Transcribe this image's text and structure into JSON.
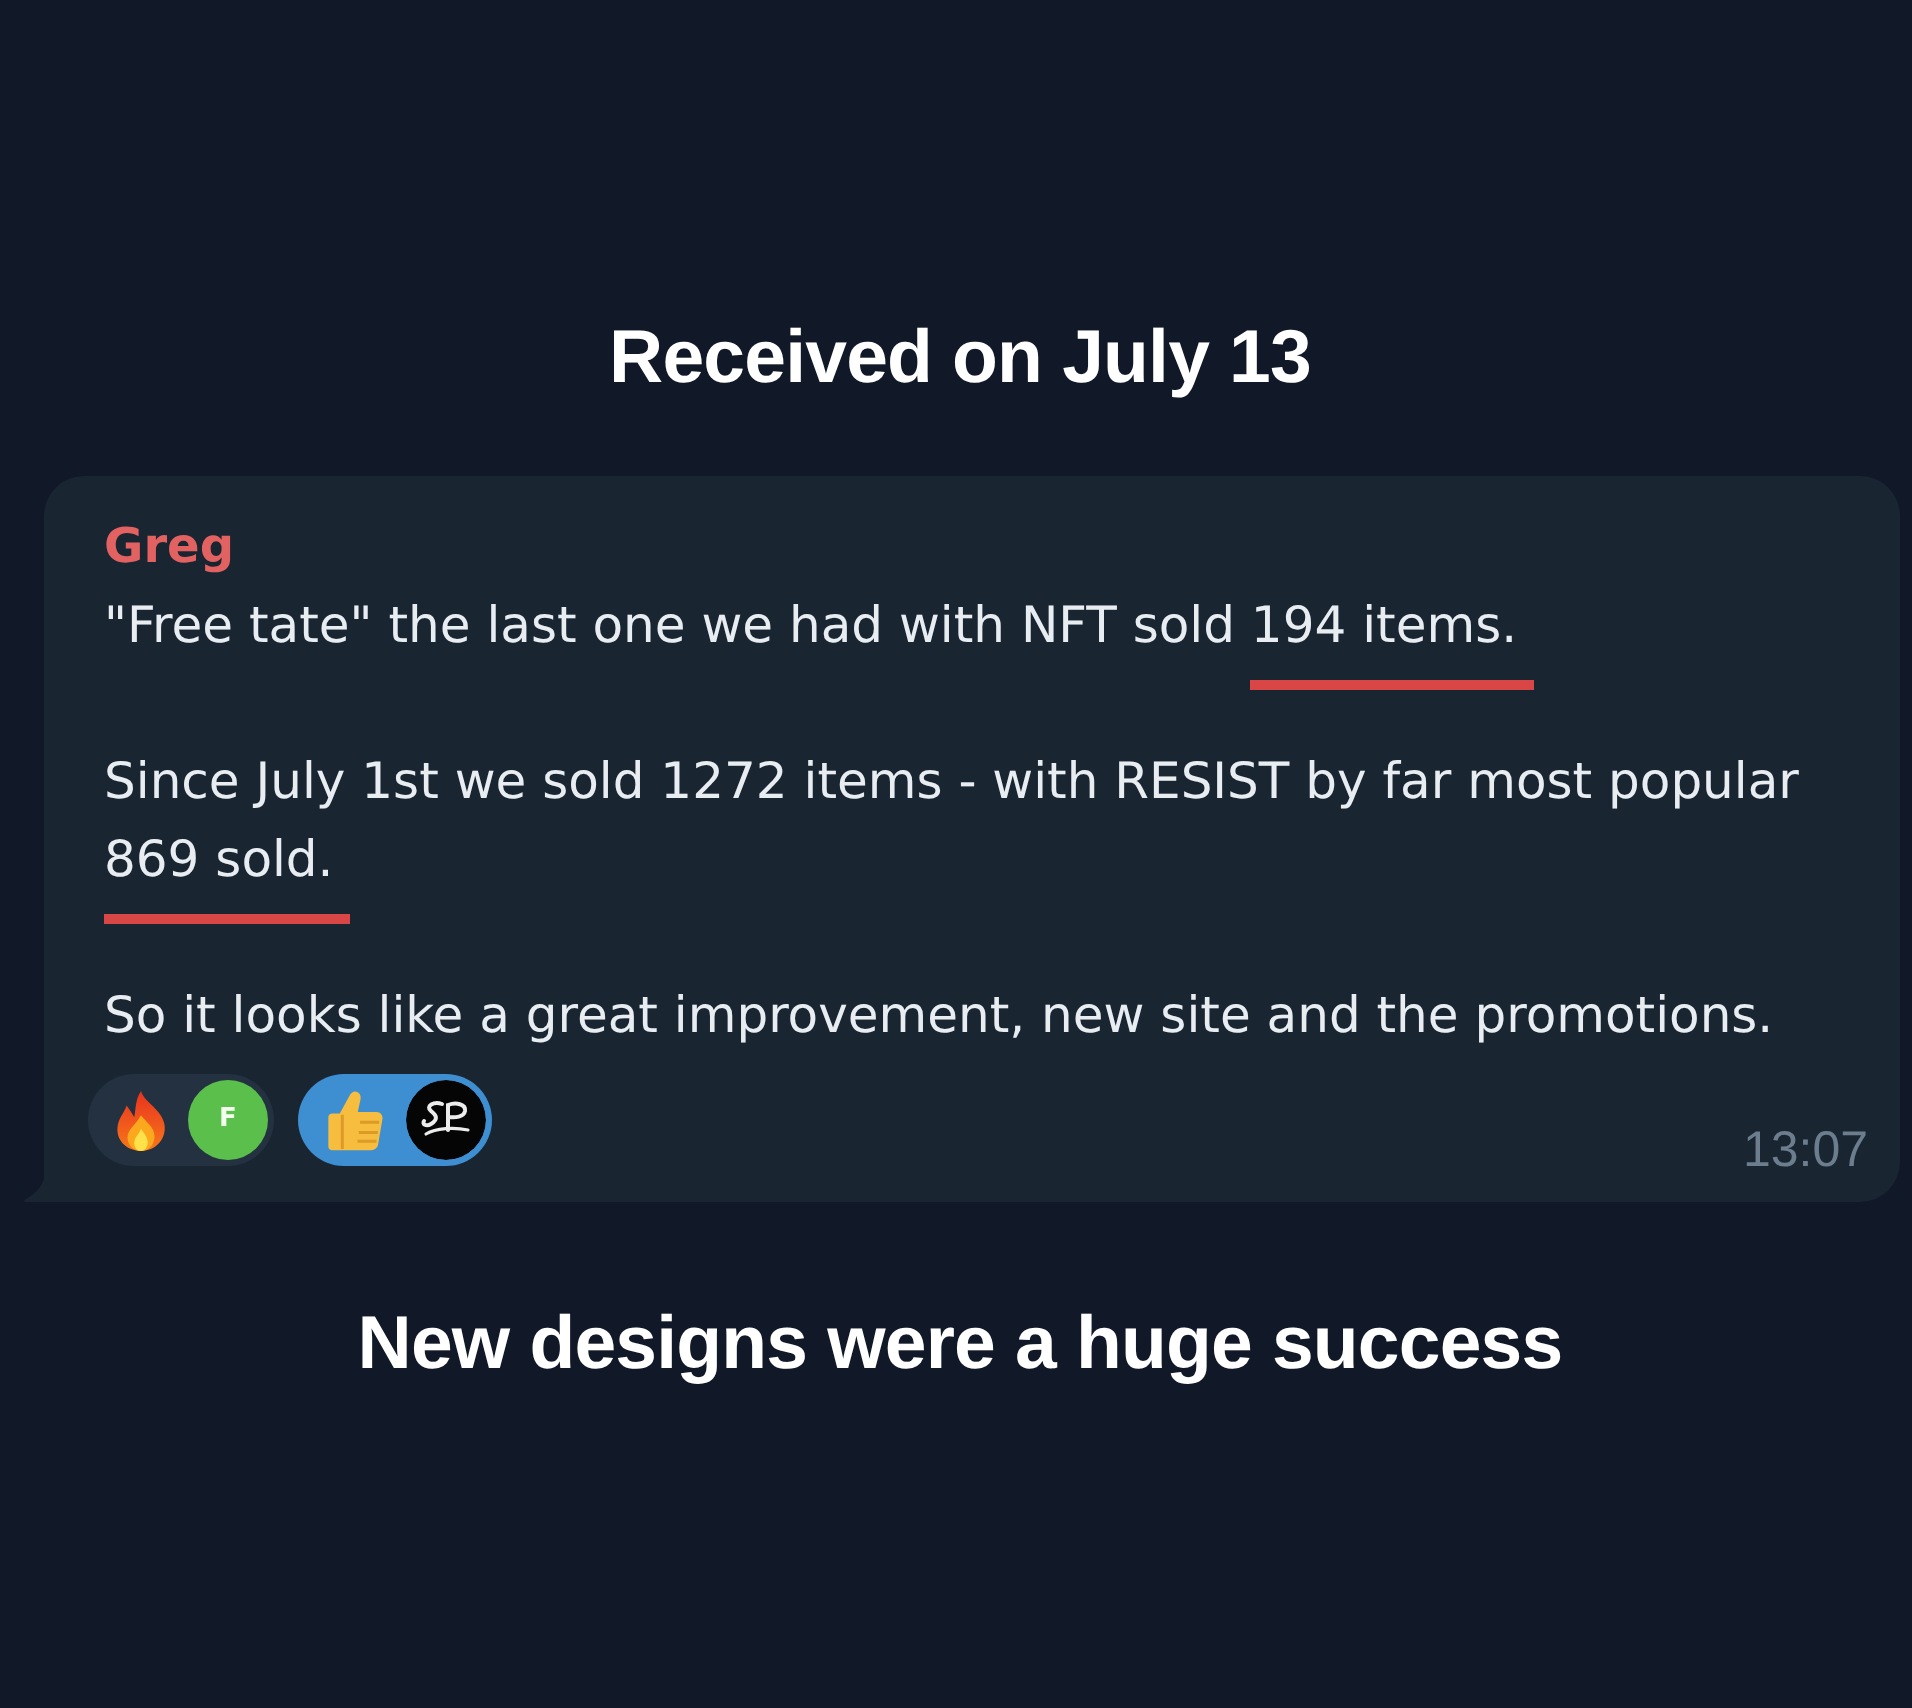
{
  "headline": "Received on July 13",
  "message": {
    "sender": "Greg",
    "paragraphs": [
      {
        "segments": [
          {
            "text": "\"Free tate\" the last one we had with NFT sold ",
            "underlined": false
          },
          {
            "text": "194 items.",
            "underlined": true
          }
        ]
      },
      {
        "segments": [
          {
            "text": "Since July 1st we sold 1272 items - with RESIST by far most popular ",
            "underlined": false
          },
          {
            "text": "869 sold.",
            "underlined": true
          }
        ]
      },
      {
        "segments": [
          {
            "text": "So it looks like a great improvement, new site and the promotions.",
            "underlined": false
          }
        ]
      }
    ],
    "reactions": [
      {
        "kind": "fire",
        "selected": false,
        "avatar": {
          "kind": "letter",
          "letter": "F"
        }
      },
      {
        "kind": "thumbs-up",
        "selected": true,
        "avatar": {
          "kind": "logo"
        }
      }
    ],
    "time": "13:07"
  },
  "caption": "New designs were a huge success"
}
